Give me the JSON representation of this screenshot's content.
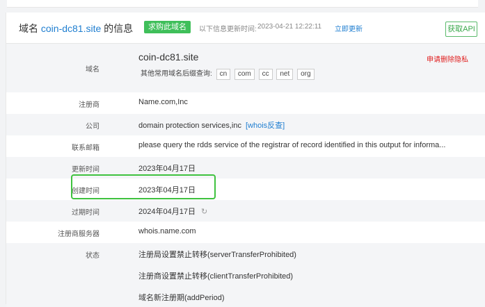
{
  "header": {
    "title_prefix": "域名 ",
    "domain": "coin-dc81.site",
    "title_suffix": " 的信息",
    "buy_button": "求购此域名",
    "update_label": "以下信息更新时间:",
    "update_time": "2023-04-21 12:22:11",
    "refresh_link": "立即更新",
    "api_button": "获取API"
  },
  "rows": {
    "domain": {
      "label": "域名",
      "value": "coin-dc81.site",
      "privacy_link": "申请删除隐私",
      "suffix_label": "其他常用域名后缀查询:",
      "suffixes": [
        "cn",
        "com",
        "cc",
        "net",
        "org"
      ]
    },
    "registrar": {
      "label": "注册商",
      "value": "Name.com,Inc"
    },
    "company": {
      "label": "公司",
      "value": "domain protection services,inc",
      "whois_link": "[whois反查]"
    },
    "email": {
      "label": "联系邮箱",
      "value": "please query the rdds service of the registrar of record identified in this output for informa..."
    },
    "updated": {
      "label": "更新时间",
      "value": "2023年04月17日"
    },
    "created": {
      "label": "创建时间",
      "value": "2023年04月17日"
    },
    "expires": {
      "label": "过期时间",
      "value": "2024年04月17日"
    },
    "nameserver": {
      "label": "注册商服务器",
      "value": "whois.name.com"
    },
    "status": {
      "label": "状态",
      "values": [
        "注册局设置禁止转移(serverTransferProhibited)",
        "注册商设置禁止转移(clientTransferProhibited)",
        "域名新注册期(addPeriod)"
      ]
    }
  },
  "icons": {
    "refresh": "refresh-spinner-icon"
  },
  "colors": {
    "accent": "#1f7ed0",
    "buy": "#3fbf5a",
    "privacy": "#e02020",
    "highlight": "#3fc23f"
  }
}
